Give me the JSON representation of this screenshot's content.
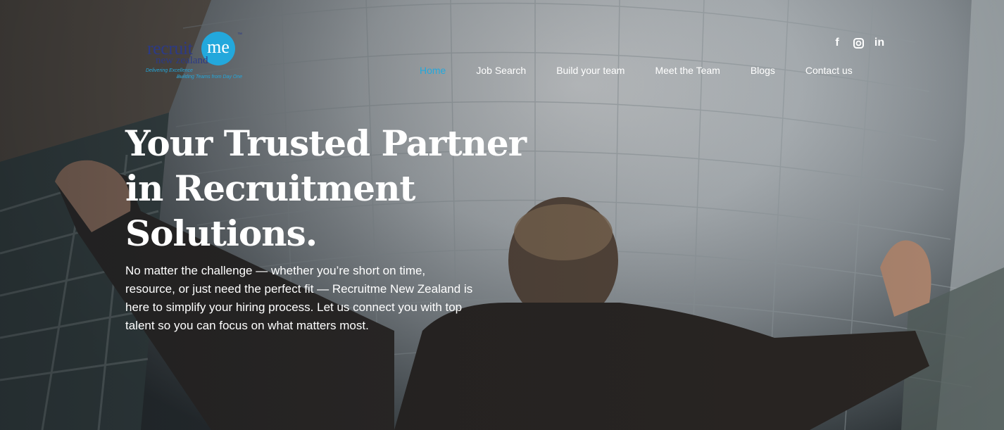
{
  "logo": {
    "word": "recruit",
    "circle_text": "me",
    "trademark": "™",
    "region": "new zealand",
    "tagline_1": "Delivering Excellence",
    "tagline_2": "Building Teams from Day One"
  },
  "social": {
    "facebook": "f",
    "instagram": "◎",
    "linkedin": "in"
  },
  "nav": {
    "items": [
      {
        "label": "Home"
      },
      {
        "label": "Job Search"
      },
      {
        "label": "Build your team"
      },
      {
        "label": "Meet the Team"
      },
      {
        "label": "Blogs"
      },
      {
        "label": "Contact us"
      }
    ]
  },
  "hero": {
    "headline": "Your Trusted Partner in Recruitment Solutions.",
    "subtext": "No matter the challenge — whether you’re short on time, resource, or just need the perfect fit — Recruitme New Zealand is here to simplify your hiring process. Let us connect you with top talent so you can focus on what matters most."
  },
  "colors": {
    "accent": "#23a8dc",
    "brand": "#2c3a86",
    "text": "#ffffff"
  }
}
